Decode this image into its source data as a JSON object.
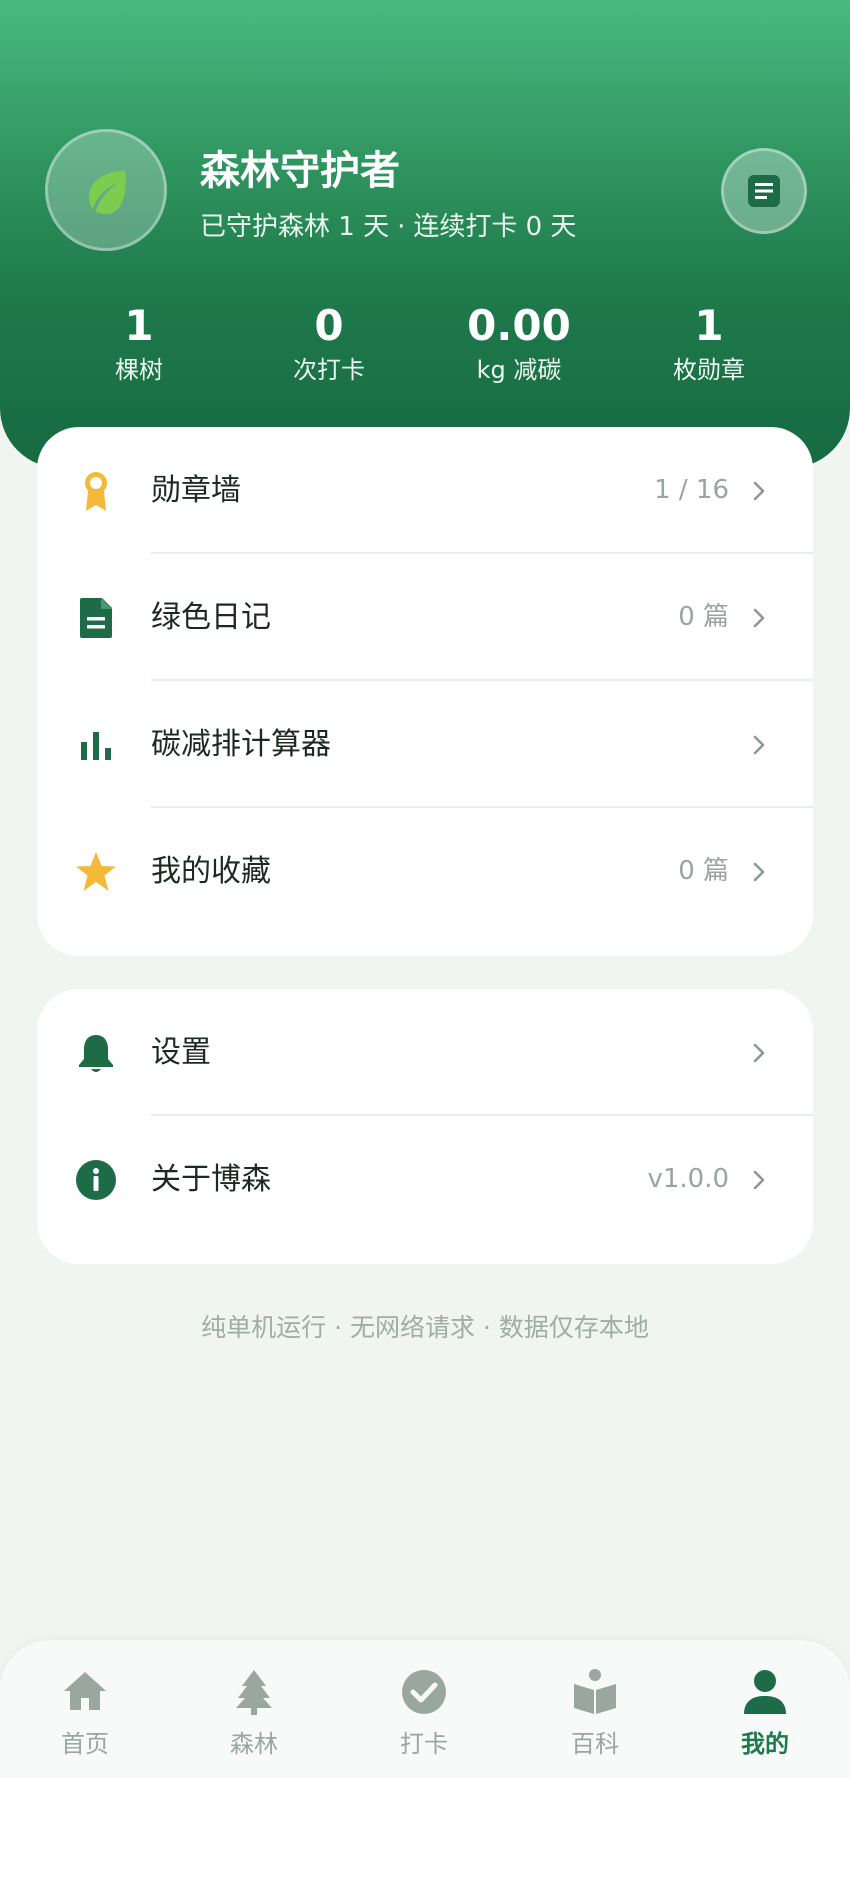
{
  "profile": {
    "name": "森林守护者",
    "subtitle_days": "已守护森林 1 天",
    "subtitle_sep": "·",
    "subtitle_streak": "连续打卡 0 天",
    "avatar_icon": "leaf-icon",
    "action_icon": "document-icon"
  },
  "stats": [
    {
      "value": "1",
      "label": "棵树"
    },
    {
      "value": "0",
      "label": "次打卡"
    },
    {
      "value": "0.00",
      "label": "kg 减碳"
    },
    {
      "value": "1",
      "label": "枚勋章"
    }
  ],
  "menu_main": [
    {
      "label": "勋章墙",
      "value": "1 / 16",
      "icon": "medal-icon"
    },
    {
      "label": "绿色日记",
      "value": "0 篇",
      "icon": "document-icon"
    },
    {
      "label": "碳减排计算器",
      "value": "",
      "icon": "bar-chart-icon"
    },
    {
      "label": "我的收藏",
      "value": "0 篇",
      "icon": "star-icon"
    }
  ],
  "menu_other": [
    {
      "label": "设置",
      "value": "",
      "icon": "bell-icon"
    },
    {
      "label": "关于博森",
      "value": "v1.0.0",
      "icon": "info-icon"
    }
  ],
  "footer_note": "纯单机运行 · 无网络请求 · 数据仅存本地",
  "tabs": [
    {
      "label": "首页",
      "icon": "home-icon",
      "active": false
    },
    {
      "label": "森林",
      "icon": "tree-icon",
      "active": false
    },
    {
      "label": "打卡",
      "icon": "check-circle-icon",
      "active": false
    },
    {
      "label": "百科",
      "icon": "book-reader-icon",
      "active": false
    },
    {
      "label": "我的",
      "icon": "person-icon",
      "active": true
    }
  ],
  "colors": {
    "primary": "#1e6b47",
    "accent_green": "#7ccd4f",
    "gold": "#f5b93a",
    "muted": "#9aa5a0",
    "background": "#f0f5f2"
  }
}
